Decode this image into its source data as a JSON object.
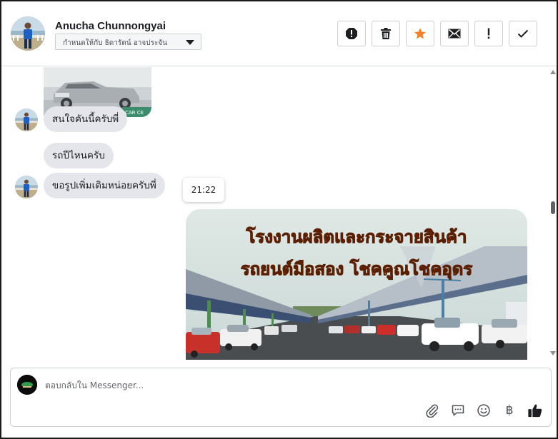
{
  "header": {
    "contact_name": "Anucha Chunnongyai",
    "assign_label": "กำหนดให้กับ ธิดารัตน์ อาจประจัน",
    "actions": [
      "report-icon",
      "trash-icon",
      "star-icon",
      "envelope-icon",
      "exclamation-icon",
      "check-icon"
    ],
    "star_color": "#f5822a"
  },
  "messages": [
    {
      "text": "สนใจคันนี้ครับพี่",
      "with_avatar": true
    },
    {
      "text": "รถปีไหนครับ",
      "with_avatar": false
    },
    {
      "text": "ขอรูปเพิ่มเติมหน่อยครับพี่",
      "with_avatar": true
    }
  ],
  "timestamp": "21:22",
  "photo_top": {
    "watermark": "CAR CE"
  },
  "photo_main": {
    "headline_1": "โรงงานผลิตและกระจายสินค้า",
    "headline_2": "รถยนต์มือสอง โชคคูณโชคอุดร",
    "headline_color": "#ff7a18"
  },
  "composer": {
    "placeholder": "ตอบกลับใน Messenger...",
    "currency_symbol": "฿",
    "icons": [
      "paperclip-icon",
      "saved-reply-icon",
      "emoji-icon",
      "baht-icon",
      "thumbs-up-icon"
    ]
  },
  "colors": {
    "bubble": "#e4e6eb",
    "border": "#ccd0d5",
    "text": "#1c1e21"
  }
}
